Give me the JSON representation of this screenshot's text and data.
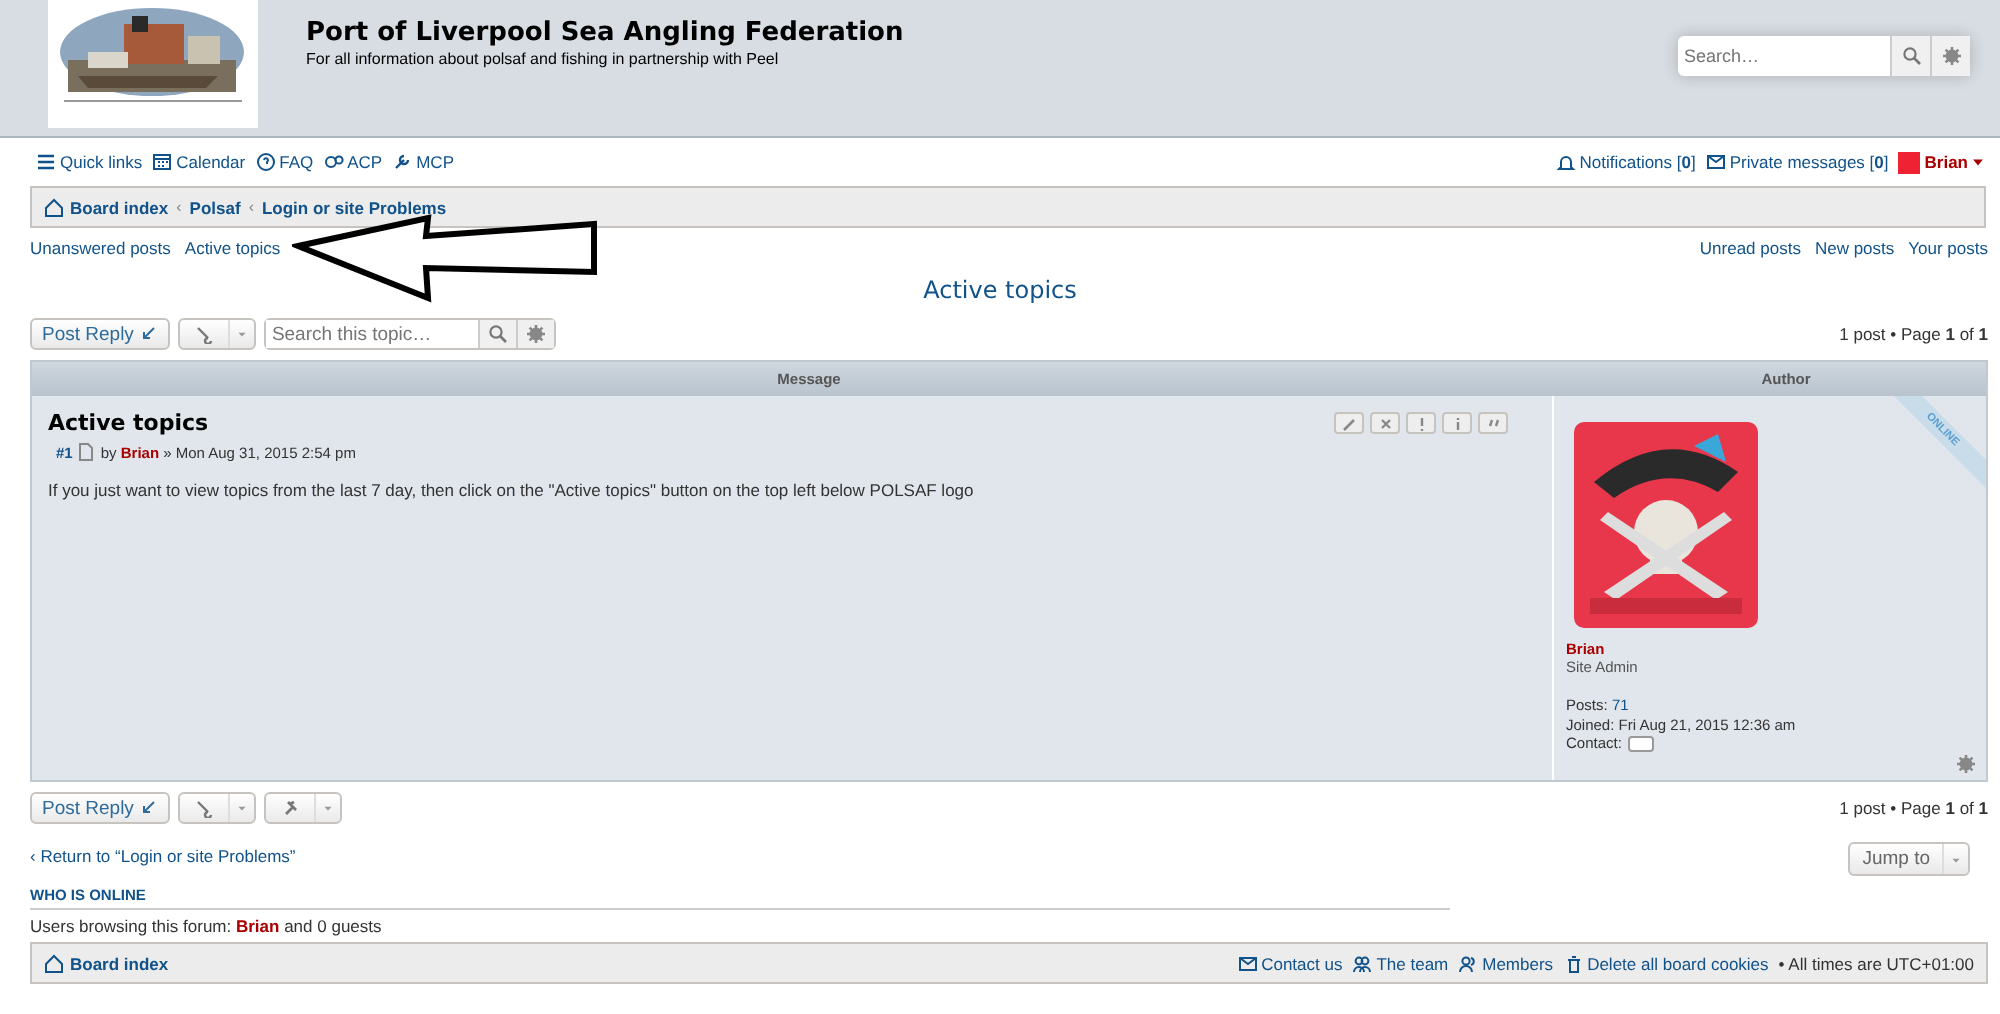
{
  "header": {
    "site_title": "Port of Liverpool Sea Angling Federation",
    "site_description": "For all information about polsaf and fishing in partnership with Peel",
    "search": {
      "placeholder": "Search…"
    }
  },
  "nav": {
    "left": [
      "Quick links",
      "Calendar",
      "FAQ",
      "ACP",
      "MCP"
    ],
    "notifications": "Notifications [**0**]",
    "messages": "Private messages [**0**]",
    "user": "Brian"
  },
  "breadcrumbs": [
    {
      "label": "Board index"
    },
    {
      "separator": "‹",
      "label": "Polsaf"
    },
    {
      "separator": "‹",
      "label": "Login or site Problems"
    }
  ],
  "quick_links_left": [
    "Unanswered posts",
    "Active topics"
  ],
  "quick_links_right": [
    "Unread posts",
    "New posts",
    "Your posts"
  ],
  "page_title": "Active topics",
  "top_actions": {
    "post_reply": "Post Reply",
    "search": {
      "placeholder": "Search this topic…"
    },
    "pagination": "1 post • Page **1** of **1**"
  },
  "post_table": {
    "columns": [
      "Message",
      "Author"
    ],
    "post": {
      "title": "Active topics",
      "number": "#1",
      "meta": "by **Brian** » Mon Aug 31, 2015 2:54 pm",
      "body": "If you just want to view topics from the last 7 day, then click on the \"Active topics\" button on the top left below POLSAF logo",
      "online_badge": "ONLINE",
      "online": true,
      "profile": {
        "name": "Brian",
        "rank": "Site Admin",
        "fields": [
          {
            "label": "Posts:",
            "value": "71",
            "link": true
          },
          {
            "label": "Joined:",
            "value": "Fri Aug 21, 2015 12:36 am",
            "link": false
          }
        ],
        "contact_label": "Contact:"
      }
    }
  },
  "bottom_actions": {
    "post_reply": "Post Reply",
    "pagination": "1 post • Page **1** of **1**"
  },
  "return_link": "‹ Return to “Login or site Problems”",
  "jump_to": "Jump to",
  "who_is_online": {
    "heading": "WHO IS ONLINE",
    "text": "Users browsing this forum: **Brian** and 0 guests"
  },
  "footer": {
    "board_index": "Board index",
    "links": [
      "Contact us",
      "The team",
      "Members",
      "Delete all board cookies"
    ],
    "timezone": "• All times are UTC+01:00"
  }
}
